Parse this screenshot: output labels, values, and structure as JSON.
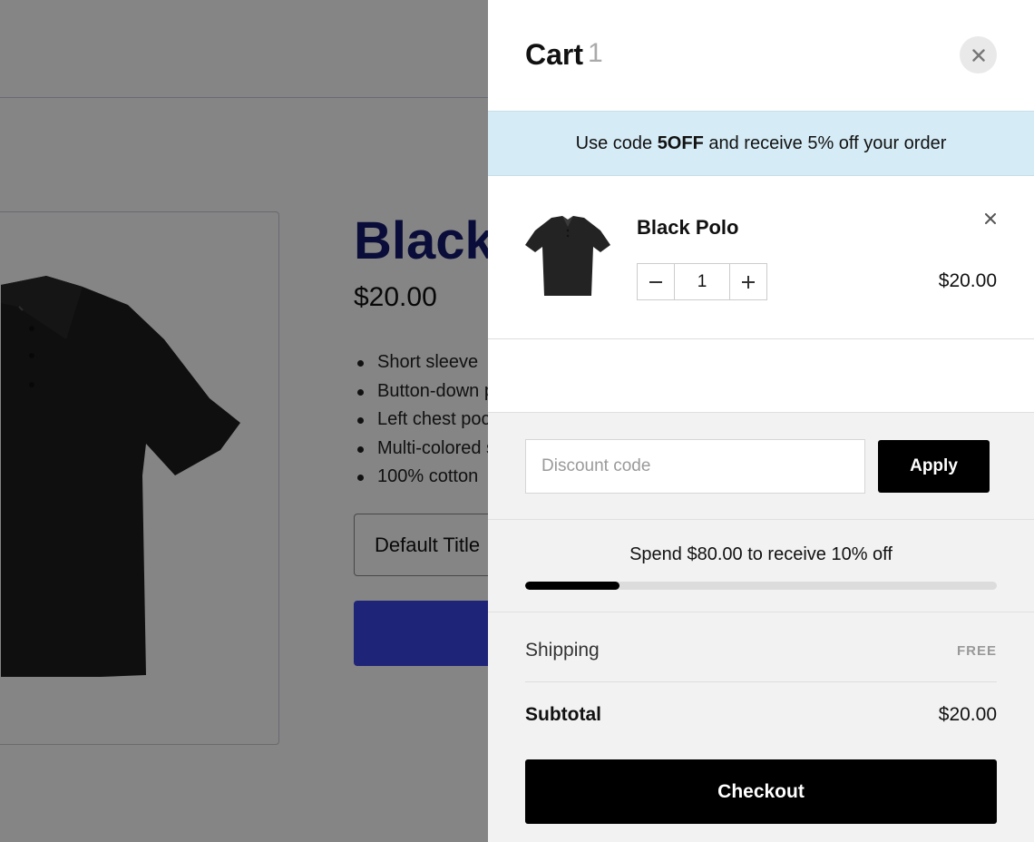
{
  "product_page": {
    "title": "Black Polo",
    "price": "$20.00",
    "features": [
      "Short sleeve",
      "Button-down placket",
      "Left chest pocket",
      "Multi-colored stitching",
      "100% cotton"
    ],
    "variant_selected": "Default Title"
  },
  "cart": {
    "title": "Cart",
    "count": "1",
    "promo": {
      "prefix": "Use code ",
      "code": "5OFF",
      "suffix": " and receive 5% off your order",
      "bg_color": "#d5ebf5"
    },
    "items": [
      {
        "name": "Black Polo",
        "quantity": "1",
        "price": "$20.00"
      }
    ],
    "discount": {
      "placeholder": "Discount code",
      "value": "",
      "apply_label": "Apply"
    },
    "progress": {
      "message": "Spend $80.00 to receive 10% off",
      "fraction": 0.2
    },
    "shipping": {
      "label": "Shipping",
      "value": "FREE"
    },
    "subtotal": {
      "label": "Subtotal",
      "value": "$20.00"
    },
    "checkout_label": "Checkout"
  },
  "icons": {
    "close": "close-icon",
    "remove": "remove-item-icon",
    "minus": "minus-icon",
    "plus": "plus-icon"
  }
}
